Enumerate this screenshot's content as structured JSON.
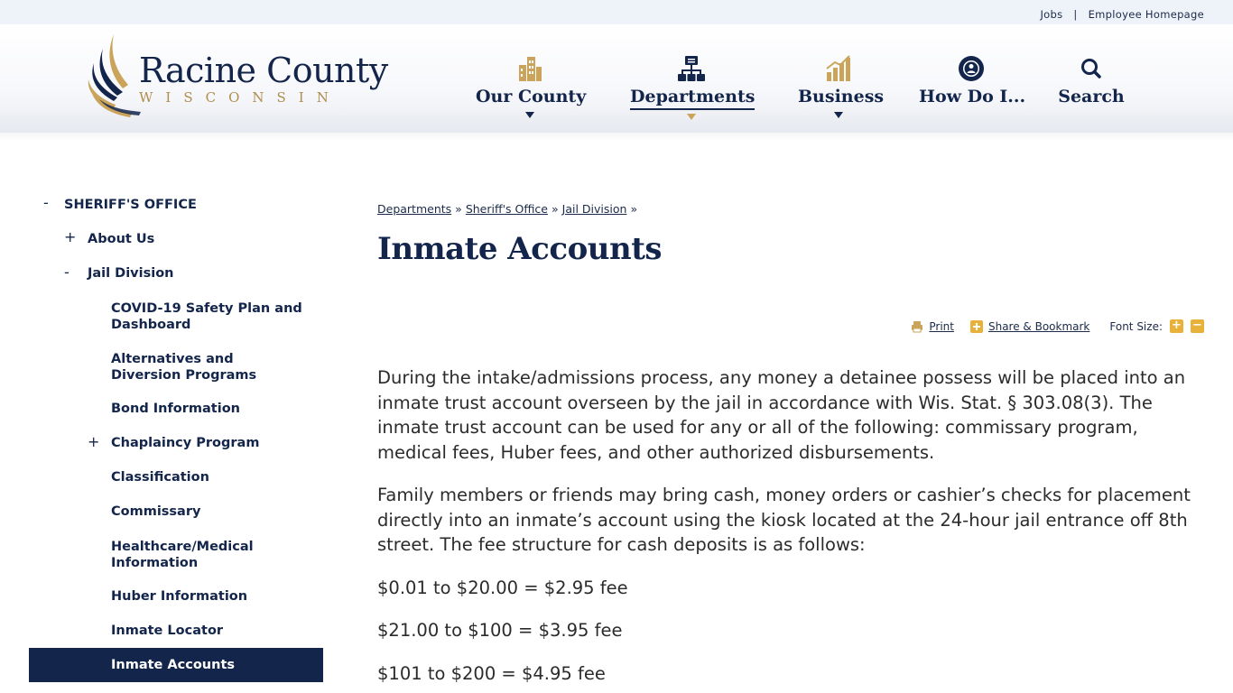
{
  "utility": {
    "jobs": "Jobs",
    "separator": "|",
    "employee_homepage": "Employee Homepage"
  },
  "logo": {
    "title": "Racine County",
    "subtitle": "WISCONSIN"
  },
  "nav": {
    "our_county": "Our County",
    "departments": "Departments",
    "business": "Business",
    "how_do_i": "How Do I...",
    "search": "Search"
  },
  "sidebar": {
    "items": [
      {
        "toggle": "-",
        "label": "SHERIFF'S OFFICE"
      },
      {
        "toggle": "+",
        "label": "About Us"
      },
      {
        "toggle": "-",
        "label": "Jail Division"
      },
      {
        "toggle": "",
        "label": "COVID-19 Safety Plan and Dashboard"
      },
      {
        "toggle": "",
        "label": "Alternatives and Diversion Programs"
      },
      {
        "toggle": "",
        "label": "Bond Information"
      },
      {
        "toggle": "+",
        "label": "Chaplaincy Program"
      },
      {
        "toggle": "",
        "label": "Classification"
      },
      {
        "toggle": "",
        "label": "Commissary"
      },
      {
        "toggle": "",
        "label": "Healthcare/Medical Information"
      },
      {
        "toggle": "",
        "label": "Huber Information"
      },
      {
        "toggle": "",
        "label": "Inmate Locator"
      },
      {
        "toggle": "",
        "label": "Inmate Accounts"
      }
    ]
  },
  "breadcrumb": {
    "items": [
      "Departments",
      "Sheriff's Office",
      "Jail Division"
    ],
    "separator": "»"
  },
  "page": {
    "title": "Inmate Accounts"
  },
  "tools": {
    "print": "Print",
    "share": "Share & Bookmark",
    "font_size": "Font Size:",
    "increase": "+",
    "decrease": "−"
  },
  "content": {
    "paragraphs": [
      "During the intake/admissions process, any money a detainee possess will be placed into an inmate trust account overseen by the jail in accordance with Wis. Stat. § 303.08(3).  The inmate trust account can be used for any or all of the following: commissary program, medical fees, Huber fees, and other authorized disbursements.",
      "Family members or friends may bring cash, money orders or cashier’s checks for placement directly into an inmate’s account using the kiosk located at the 24-hour jail entrance off 8th street.  The fee structure for cash deposits is as follows:"
    ],
    "fees": [
      "$0.01 to $20.00 = $2.95 fee",
      "$21.00 to $100 = $3.95 fee",
      "$101 to $200 = $4.95 fee"
    ]
  },
  "colors": {
    "navy": "#13254b",
    "gold": "#c9a45a",
    "accent_button": "#e8b23a"
  }
}
